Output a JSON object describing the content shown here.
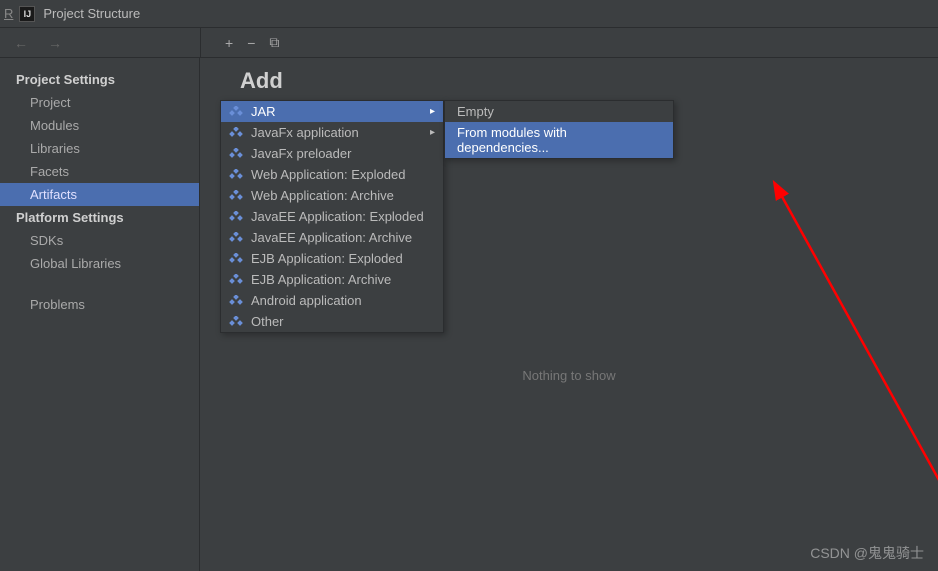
{
  "titlebar": {
    "left_char": "R",
    "title": "Project Structure"
  },
  "sidebar": {
    "heading1": "Project Settings",
    "items1": [
      {
        "label": "Project"
      },
      {
        "label": "Modules"
      },
      {
        "label": "Libraries"
      },
      {
        "label": "Facets"
      },
      {
        "label": "Artifacts",
        "selected": true
      }
    ],
    "heading2": "Platform Settings",
    "items2": [
      {
        "label": "SDKs"
      },
      {
        "label": "Global Libraries"
      }
    ],
    "problems": "Problems"
  },
  "toolbar": {
    "plus": "+",
    "minus": "−",
    "copy": "⧉"
  },
  "content": {
    "add_title": "Add",
    "nothing": "Nothing to show"
  },
  "menu1": [
    {
      "label": "JAR",
      "icon": "module",
      "submenu": true,
      "selected": true
    },
    {
      "label": "JavaFx application",
      "icon": "module",
      "submenu": true
    },
    {
      "label": "JavaFx preloader",
      "icon": "module"
    },
    {
      "label": "Web Application: Exploded",
      "icon": "web"
    },
    {
      "label": "Web Application: Archive",
      "icon": "web-archive"
    },
    {
      "label": "JavaEE Application: Exploded",
      "icon": "web"
    },
    {
      "label": "JavaEE Application: Archive",
      "icon": "web-archive"
    },
    {
      "label": "EJB Application: Exploded",
      "icon": "module"
    },
    {
      "label": "EJB Application: Archive",
      "icon": "module"
    },
    {
      "label": "Android application",
      "icon": "module"
    },
    {
      "label": "Other",
      "icon": "module"
    }
  ],
  "menu2": [
    {
      "label": "Empty"
    },
    {
      "label": "From modules with dependencies...",
      "selected": true
    }
  ],
  "watermark": "CSDN @鬼鬼骑士"
}
